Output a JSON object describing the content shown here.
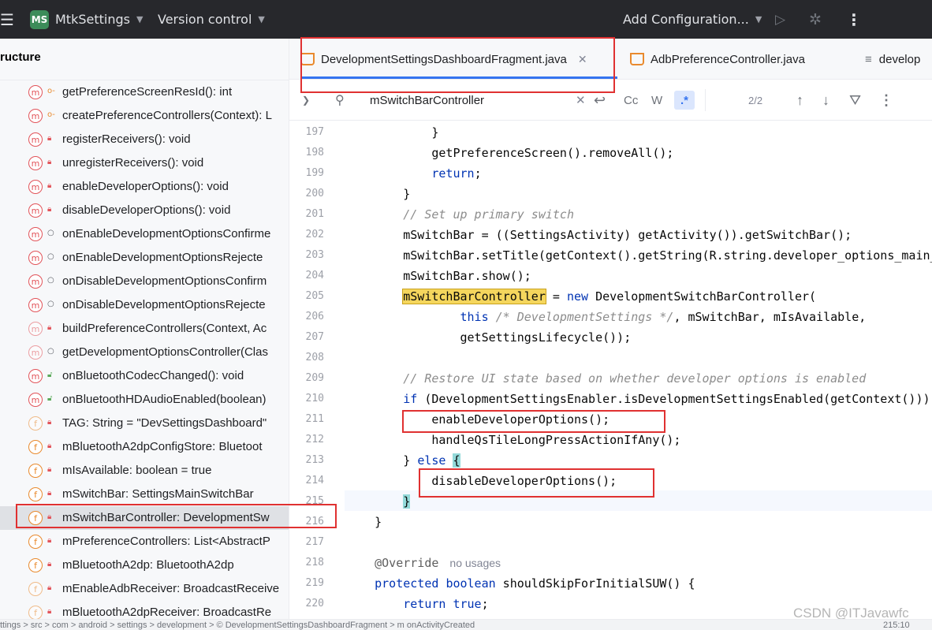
{
  "toolbar": {
    "project_badge": "MS",
    "project_name": "MtkSettings",
    "vcs_label": "Version control",
    "run_config_label": "Add Configuration..."
  },
  "structure": {
    "title": "ructure",
    "items": [
      {
        "kind": "m",
        "vis": "key",
        "label": "getPreferenceScreenResId(): int"
      },
      {
        "kind": "m",
        "vis": "key",
        "label": "createPreferenceControllers(Context): L"
      },
      {
        "kind": "m",
        "vis": "lock",
        "label": "registerReceivers(): void"
      },
      {
        "kind": "m",
        "vis": "lock",
        "label": "unregisterReceivers(): void"
      },
      {
        "kind": "m",
        "vis": "lock",
        "label": "enableDeveloperOptions(): void"
      },
      {
        "kind": "m",
        "vis": "lock",
        "label": "disableDeveloperOptions(): void"
      },
      {
        "kind": "m",
        "vis": "circle",
        "label": "onEnableDevelopmentOptionsConfirme"
      },
      {
        "kind": "m",
        "vis": "circle",
        "label": "onEnableDevelopmentOptionsRejecte"
      },
      {
        "kind": "m",
        "vis": "circle",
        "label": "onDisableDevelopmentOptionsConfirm"
      },
      {
        "kind": "m",
        "vis": "circle",
        "label": "onDisableDevelopmentOptionsRejecte"
      },
      {
        "kind": "m",
        "vis": "lock",
        "label": "buildPreferenceControllers(Context, Ac"
      },
      {
        "kind": "m",
        "vis": "circle",
        "label": "getDevelopmentOptionsController(Clas"
      },
      {
        "kind": "m",
        "vis": "lock-open",
        "label": "onBluetoothCodecChanged(): void"
      },
      {
        "kind": "m",
        "vis": "lock-open",
        "label": "onBluetoothHDAudioEnabled(boolean)"
      },
      {
        "kind": "f",
        "vis": "lock",
        "label": "TAG: String = \"DevSettingsDashboard\""
      },
      {
        "kind": "f",
        "vis": "lock",
        "label": "mBluetoothA2dpConfigStore: Bluetoot"
      },
      {
        "kind": "f",
        "vis": "lock",
        "label": "mIsAvailable: boolean = true"
      },
      {
        "kind": "f",
        "vis": "lock",
        "label": "mSwitchBar: SettingsMainSwitchBar"
      },
      {
        "kind": "f",
        "vis": "lock",
        "label": "mSwitchBarController: DevelopmentSw"
      },
      {
        "kind": "f",
        "vis": "lock",
        "label": "mPreferenceControllers: List<AbstractP"
      },
      {
        "kind": "f",
        "vis": "lock",
        "label": "mBluetoothA2dp: BluetoothA2dp"
      },
      {
        "kind": "f",
        "vis": "lock",
        "label": "mEnableAdbReceiver: BroadcastReceive"
      },
      {
        "kind": "f",
        "vis": "lock",
        "label": "mBluetoothA2dpReceiver: BroadcastRe"
      }
    ]
  },
  "tabs": [
    {
      "label": "DevelopmentSettingsDashboardFragment.java"
    },
    {
      "label": "AdbPreferenceController.java"
    },
    {
      "label": "develop"
    }
  ],
  "search": {
    "query": "mSwitchBarController",
    "match_case_label": "Cc",
    "words_label": "W",
    "regex_label": ".*",
    "count": "2/2"
  },
  "editor": {
    "hint_no_usages": "no usages",
    "line_numbers": [
      "197",
      "198",
      "199",
      "200",
      "201",
      "202",
      "203",
      "204",
      "205",
      "206",
      "207",
      "208",
      "209",
      "210",
      "211",
      "212",
      "213",
      "214",
      "215",
      "216",
      "217",
      "218",
      "219",
      "220"
    ],
    "lines": [
      {
        "text": "            }"
      },
      {
        "text": "            getPreferenceScreen().removeAll();"
      },
      {
        "text": "            return;"
      },
      {
        "text": "        }"
      },
      {
        "text": "        // Set up primary switch"
      },
      {
        "text": "        mSwitchBar = ((SettingsActivity) getActivity()).getSwitchBar();"
      },
      {
        "text": "        mSwitchBar.setTitle(getContext().getString(R.string.developer_options_main_"
      },
      {
        "text": "        mSwitchBar.show();"
      },
      {
        "text": "        mSwitchBarController = new DevelopmentSwitchBarController("
      },
      {
        "text": "                this /* DevelopmentSettings */, mSwitchBar, mIsAvailable,"
      },
      {
        "text": "                getSettingsLifecycle());"
      },
      {
        "text": ""
      },
      {
        "text": "        // Restore UI state based on whether developer options is enabled"
      },
      {
        "text": "        if (DevelopmentSettingsEnabler.isDevelopmentSettingsEnabled(getContext()))"
      },
      {
        "text": "            enableDeveloperOptions();"
      },
      {
        "text": "            handleQsTileLongPressActionIfAny();"
      },
      {
        "text": "        } else {"
      },
      {
        "text": "            disableDeveloperOptions();"
      },
      {
        "text": "        }"
      },
      {
        "text": "    }"
      },
      {
        "text": ""
      },
      {
        "text": "    @Override"
      },
      {
        "text": "    protected boolean shouldSkipForInitialSUW() {"
      },
      {
        "text": "        return true;"
      }
    ]
  },
  "status": {
    "path": "ttings > src > com > android > settings > development > © DevelopmentSettingsDashboardFragment > m onActivityCreated",
    "position": "215:10"
  },
  "watermark": "CSDN @ITJavawfc",
  "colors": {
    "toolbar_bg": "#27282c",
    "annotation_red": "#e03131",
    "keyword_blue": "#0033b3",
    "search_highlight": "#f5d65d"
  }
}
